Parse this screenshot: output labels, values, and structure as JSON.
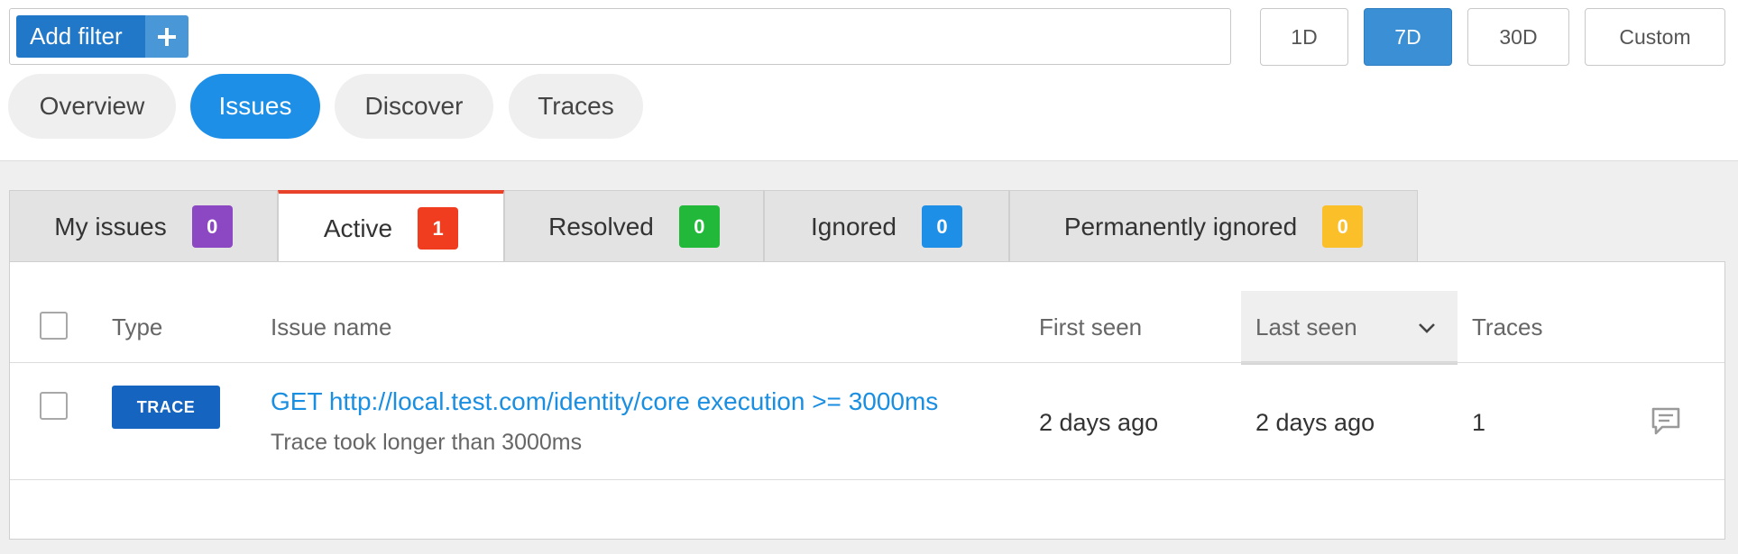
{
  "filter": {
    "add_label": "Add filter"
  },
  "time_ranges": [
    {
      "label": "1D",
      "active": false
    },
    {
      "label": "7D",
      "active": true
    },
    {
      "label": "30D",
      "active": false
    },
    {
      "label": "Custom",
      "active": false
    }
  ],
  "nav": [
    {
      "label": "Overview",
      "active": false
    },
    {
      "label": "Issues",
      "active": true
    },
    {
      "label": "Discover",
      "active": false
    },
    {
      "label": "Traces",
      "active": false
    }
  ],
  "issue_tabs": [
    {
      "label": "My issues",
      "count": "0",
      "color": "#8c47c2",
      "active": false
    },
    {
      "label": "Active",
      "count": "1",
      "color": "#f03c1f",
      "active": true
    },
    {
      "label": "Resolved",
      "count": "0",
      "color": "#22b83a",
      "active": false
    },
    {
      "label": "Ignored",
      "count": "0",
      "color": "#1e8fe6",
      "active": false
    },
    {
      "label": "Permanently ignored",
      "count": "0",
      "color": "#fbbf2a",
      "active": false
    }
  ],
  "table": {
    "headers": {
      "type": "Type",
      "issue_name": "Issue name",
      "first_seen": "First seen",
      "last_seen": "Last seen",
      "traces": "Traces"
    },
    "rows": [
      {
        "type": "TRACE",
        "issue_name": "GET http://local.test.com/identity/core execution >= 3000ms",
        "description": "Trace took longer than 3000ms",
        "first_seen": "2 days ago",
        "last_seen": "2 days ago",
        "traces": "1"
      }
    ]
  },
  "colors": {
    "primary": "#2178c8",
    "link": "#1a8ee0",
    "active_tab_accent": "#e8432a"
  }
}
